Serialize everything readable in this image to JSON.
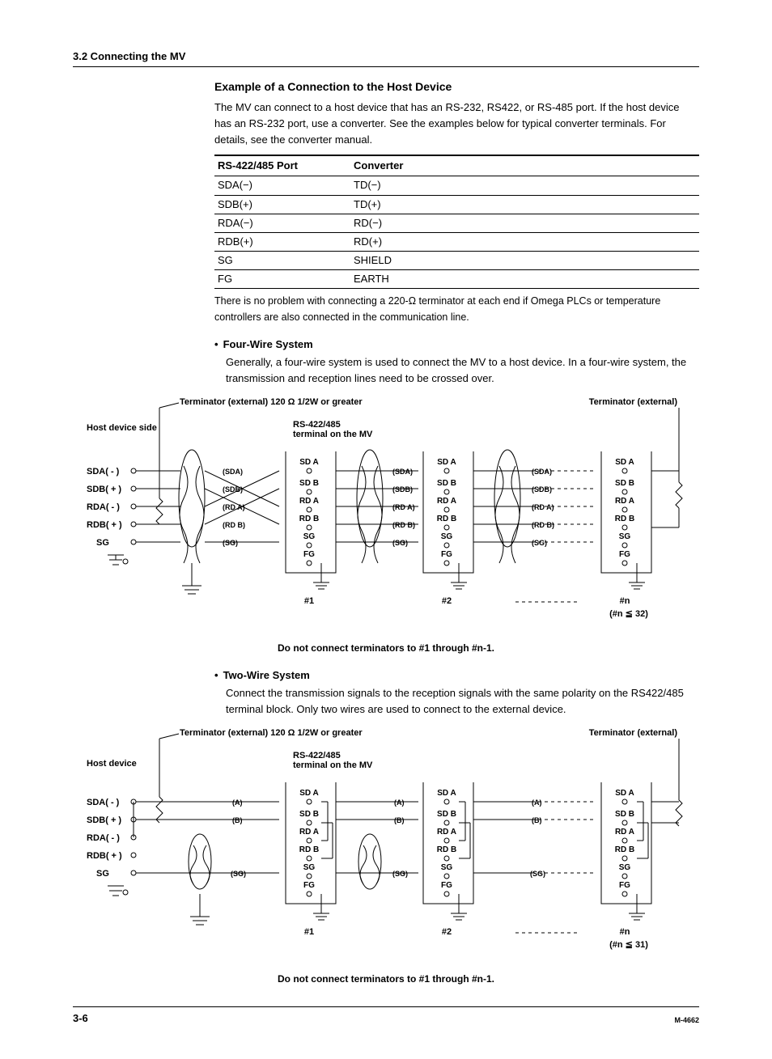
{
  "header": "3.2  Connecting the MV",
  "section": {
    "title": "Example of a Connection to the Host Device",
    "intro1": "The MV can connect to a host device that has an RS-232, RS422, or RS-485 port. If the host device has an RS-232 port, use a converter. See the examples below for typical converter terminals. For details, see the converter manual.",
    "table_header_port": "RS-422/485 Port",
    "table_header_conv": "Converter",
    "table_rows": [
      {
        "port": "SDA(−)",
        "conv": "TD(−)"
      },
      {
        "port": "SDB(+)",
        "conv": "TD(+)"
      },
      {
        "port": "RDA(−)",
        "conv": "RD(−)"
      },
      {
        "port": "RDB(+)",
        "conv": "RD(+)"
      },
      {
        "port": "SG",
        "conv": "SHIELD"
      },
      {
        "port": "FG",
        "conv": "EARTH"
      }
    ],
    "note": "There is no problem with connecting a 220-Ω terminator at each end if Omega PLCs or temperature controllers are also connected in the communication line."
  },
  "four_wire": {
    "heading": "Four-Wire System",
    "para": "Generally, a four-wire system is used to connect the MV to a host device. In a four-wire system, the transmission and reception lines need to be crossed over.",
    "term_left": "Terminator (external) 120 Ω 1/2W or greater",
    "term_right": "Terminator (external)",
    "host_side": "Host device side",
    "terminal_label": "RS-422/485 terminal on the MV",
    "host_pins": [
      "SDA( - )",
      "SDB( + )",
      "RDA( - )",
      "RDB( + )",
      "SG"
    ],
    "wire_labels": [
      "(SDA)",
      "(SDB)",
      "(RD A)",
      "(RD B)",
      "(SG)"
    ],
    "dev_pins": [
      "SD  A",
      "SD  B",
      "RD  A",
      "RD  B",
      "SG",
      "FG"
    ],
    "dev_nums": [
      "#1",
      "#2",
      "#n"
    ],
    "n_limit": "(#n ≦ 32)",
    "note": "Do not connect terminators to #1 through #n-1."
  },
  "two_wire": {
    "heading": "Two-Wire System",
    "para": "Connect the transmission signals to the reception signals with the same polarity on the RS422/485 terminal block. Only two wires are used to connect to the external device.",
    "term_left": "Terminator (external) 120 Ω 1/2W or greater",
    "term_right": "Terminator (external)",
    "host_side": "Host device",
    "terminal_label": "RS-422/485 terminal on the MV",
    "host_pins": [
      "SDA( - )",
      "SDB( + )",
      "RDA( - )",
      "RDB( + )",
      "SG"
    ],
    "wire_labels": [
      "(A)",
      "(B)",
      "(SG)"
    ],
    "dev_pins": [
      "SD  A",
      "SD  B",
      "RD  A",
      "RD  B",
      "SG",
      "FG"
    ],
    "dev_nums": [
      "#1",
      "#2",
      "#n"
    ],
    "n_limit": "(#n ≦ 31)",
    "note": "Do not connect terminators to #1 through #n-1."
  },
  "footer": {
    "page": "3-6",
    "doc": "M-4662"
  }
}
